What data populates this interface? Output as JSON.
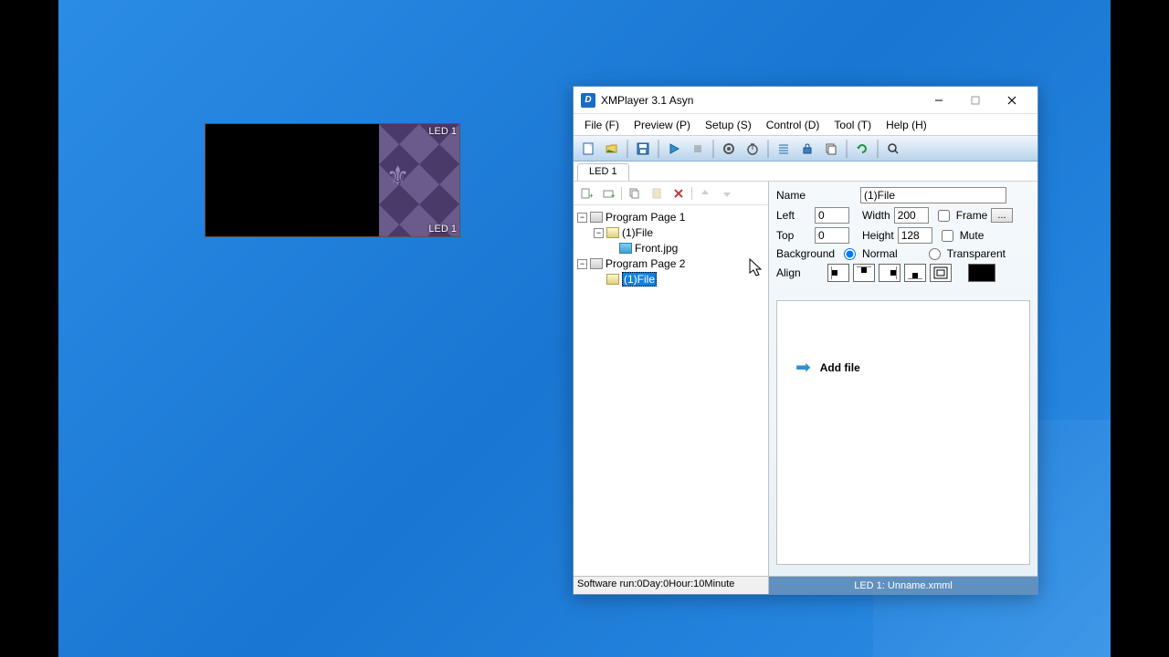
{
  "desktop": {
    "preview_label": "LED 1"
  },
  "window": {
    "title": "XMPlayer 3.1 Asyn",
    "app_initial": "D"
  },
  "menu": {
    "file": "File (F)",
    "preview": "Preview (P)",
    "setup": "Setup (S)",
    "control": "Control (D)",
    "tool": "Tool (T)",
    "help": "Help (H)"
  },
  "tab": {
    "led1": "LED 1"
  },
  "tree": {
    "page1": "Program Page  1",
    "file1": "(1)File",
    "front": "Front.jpg",
    "page2": "Program Page  2",
    "file2": "(1)File"
  },
  "props": {
    "name_label": "Name",
    "name_value": "(1)File",
    "left_label": "Left",
    "left_value": "0",
    "width_label": "Width",
    "width_value": "200",
    "frame_label": "Frame",
    "browse": "...",
    "top_label": "Top",
    "top_value": "0",
    "height_label": "Height",
    "height_value": "128",
    "mute_label": "Mute",
    "bg_label": "Background",
    "bg_normal": "Normal",
    "bg_transparent": "Transparent",
    "align_label": "Align"
  },
  "addfile": {
    "label": "Add file"
  },
  "status": {
    "left": "Software run:0Day:0Hour:10Minute",
    "right": "LED 1: Unname.xmml"
  }
}
